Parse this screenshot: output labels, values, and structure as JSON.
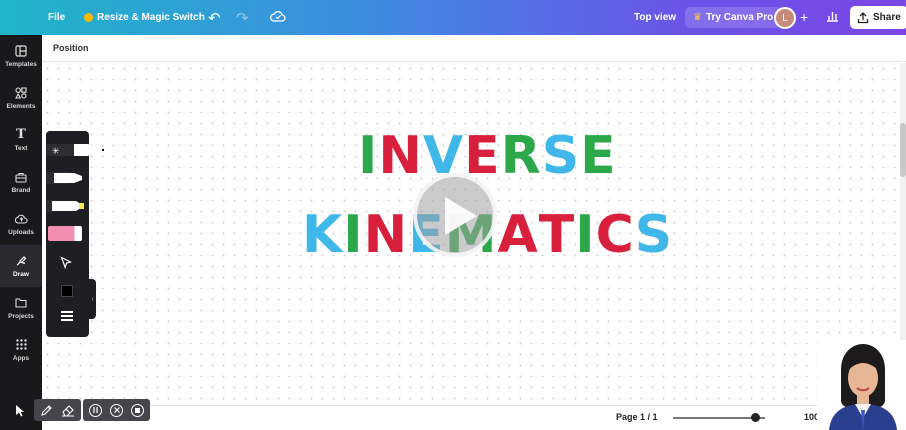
{
  "topbar": {
    "file": "File",
    "resize": "Resize & Magic Switch",
    "top_view": "Top view",
    "try_pro": "Try Canva Pro",
    "avatar_initial": "L",
    "share": "Share"
  },
  "sidebar": {
    "items": [
      {
        "label": "Templates"
      },
      {
        "label": "Elements"
      },
      {
        "label": "Text"
      },
      {
        "label": "Brand"
      },
      {
        "label": "Uploads"
      },
      {
        "label": "Draw"
      },
      {
        "label": "Projects"
      },
      {
        "label": "Apps"
      }
    ]
  },
  "canvas": {
    "header": "Position",
    "title_line1": [
      {
        "ch": "I",
        "color": "#2aa84a"
      },
      {
        "ch": "N",
        "color": "#d81f3c"
      },
      {
        "ch": "V",
        "color": "#3fb7e8"
      },
      {
        "ch": "E",
        "color": "#d81f3c"
      },
      {
        "ch": "R",
        "color": "#2aa84a"
      },
      {
        "ch": "S",
        "color": "#3fb7e8"
      },
      {
        "ch": "E",
        "color": "#2aa84a"
      }
    ],
    "title_line2": [
      {
        "ch": "K",
        "color": "#3fb7e8"
      },
      {
        "ch": "I",
        "color": "#2aa84a"
      },
      {
        "ch": "N",
        "color": "#d81f3c"
      },
      {
        "ch": "E",
        "color": "#3fb7e8"
      },
      {
        "ch": "M",
        "color": "#2aa84a"
      },
      {
        "ch": "A",
        "color": "#d81f3c"
      },
      {
        "ch": "T",
        "color": "#d81f3c"
      },
      {
        "ch": "I",
        "color": "#2aa84a"
      },
      {
        "ch": "C",
        "color": "#d81f3c"
      },
      {
        "ch": "S",
        "color": "#3fb7e8"
      }
    ]
  },
  "footer": {
    "page_indicator": "Page 1 / 1",
    "zoom": "100",
    "zoom_fraction": 0.9
  },
  "colors": {
    "accent_teal": "#1fb5c9",
    "accent_purple": "#7b45e6",
    "sidebar_bg": "#18191b"
  }
}
